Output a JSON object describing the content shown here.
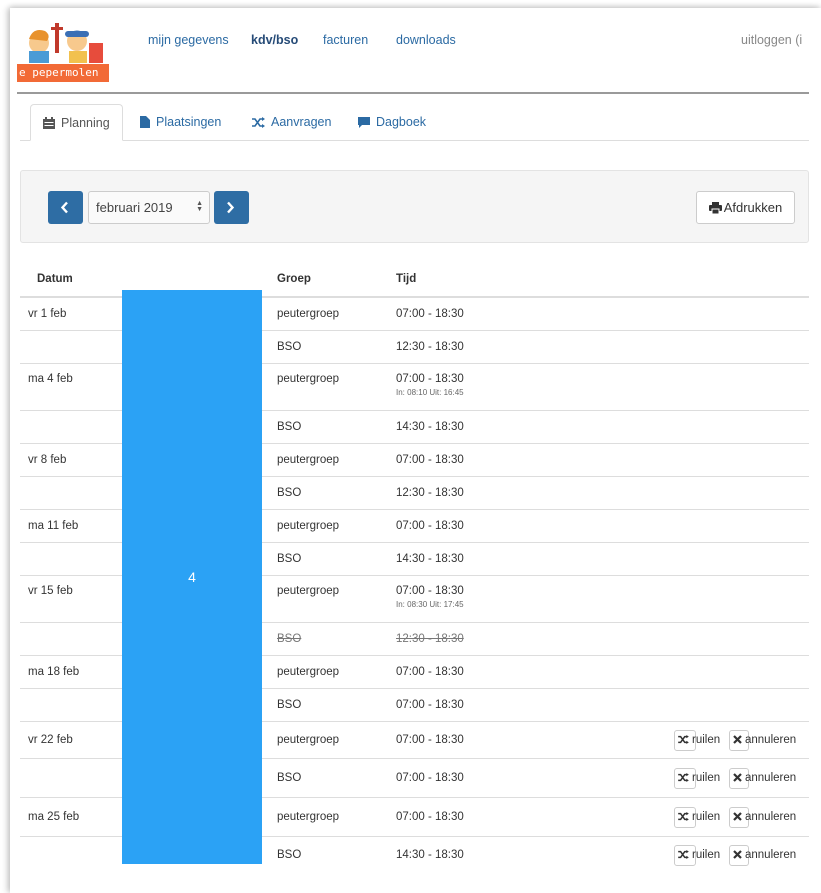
{
  "header": {
    "logo_text": "e pepermolen",
    "nav": [
      {
        "label": "mijn gegevens",
        "active": false
      },
      {
        "label": "kdv/bso",
        "active": true
      },
      {
        "label": "facturen",
        "active": false
      },
      {
        "label": "downloads",
        "active": false
      }
    ],
    "logout_label": "uitloggen (i"
  },
  "tabs": [
    {
      "label": "Planning",
      "icon": "calendar-icon",
      "active": true
    },
    {
      "label": "Plaatsingen",
      "icon": "file-icon",
      "active": false
    },
    {
      "label": "Aanvragen",
      "icon": "shuffle-icon",
      "active": false
    },
    {
      "label": "Dagboek",
      "icon": "comment-icon",
      "active": false
    }
  ],
  "month_bar": {
    "prev_icon": "chevron-left-icon",
    "next_icon": "chevron-right-icon",
    "selected_month": "februari 2019",
    "print_label": "Afdrukken",
    "print_icon": "print-icon"
  },
  "table": {
    "headers": {
      "datum": "Datum",
      "groep": "Groep",
      "tijd": "Tijd"
    },
    "rows": [
      {
        "datum": "vr 1 feb",
        "groep": "peutergroep",
        "tijd": "07:00 - 18:30",
        "sub": "",
        "strike": false,
        "actions": false
      },
      {
        "datum": "",
        "groep": "BSO",
        "tijd": "12:30 - 18:30",
        "sub": "",
        "strike": false,
        "actions": false
      },
      {
        "datum": "ma 4 feb",
        "groep": "peutergroep",
        "tijd": "07:00 - 18:30",
        "sub": "In: 08:10 Uit: 16:45",
        "strike": false,
        "actions": false
      },
      {
        "datum": "",
        "groep": "BSO",
        "tijd": "14:30 - 18:30",
        "sub": "",
        "strike": false,
        "actions": false
      },
      {
        "datum": "vr 8 feb",
        "groep": "peutergroep",
        "tijd": "07:00 - 18:30",
        "sub": "",
        "strike": false,
        "actions": false
      },
      {
        "datum": "",
        "groep": "BSO",
        "tijd": "12:30 - 18:30",
        "sub": "",
        "strike": false,
        "actions": false
      },
      {
        "datum": "ma 11 feb",
        "groep": "peutergroep",
        "tijd": "07:00 - 18:30",
        "sub": "",
        "strike": false,
        "actions": false
      },
      {
        "datum": "",
        "groep": "BSO",
        "tijd": "14:30 - 18:30",
        "sub": "",
        "strike": false,
        "actions": false
      },
      {
        "datum": "vr 15 feb",
        "groep": "peutergroep",
        "tijd": "07:00 - 18:30",
        "sub": "In: 08:30 Uit: 17:45",
        "strike": false,
        "actions": false
      },
      {
        "datum": "",
        "groep": "BSO",
        "tijd": "12:30 - 18:30",
        "sub": "",
        "strike": true,
        "actions": false
      },
      {
        "datum": "ma 18 feb",
        "groep": "peutergroep",
        "tijd": "07:00 - 18:30",
        "sub": "",
        "strike": false,
        "actions": false
      },
      {
        "datum": "",
        "groep": "BSO",
        "tijd": "07:00 - 18:30",
        "sub": "",
        "strike": false,
        "actions": false
      },
      {
        "datum": "vr 22 feb",
        "groep": "peutergroep",
        "tijd": "07:00 - 18:30",
        "sub": "",
        "strike": false,
        "actions": true
      },
      {
        "datum": "",
        "groep": "BSO",
        "tijd": "07:00 - 18:30",
        "sub": "",
        "strike": false,
        "actions": true
      },
      {
        "datum": "ma 25 feb",
        "groep": "peutergroep",
        "tijd": "07:00 - 18:30",
        "sub": "",
        "strike": false,
        "actions": true
      },
      {
        "datum": "",
        "groep": "BSO",
        "tijd": "14:30 - 18:30",
        "sub": "",
        "strike": false,
        "actions": true
      }
    ],
    "action_labels": {
      "ruilen": "ruilen",
      "annuleren": "annuleren"
    }
  },
  "overlay": {
    "label": "4",
    "color": "#2ba2f5"
  }
}
